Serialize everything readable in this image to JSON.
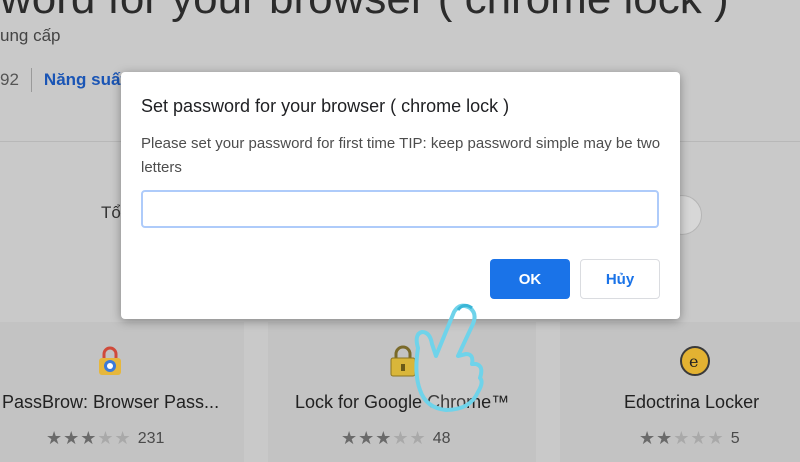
{
  "background": {
    "page_title": "word for your browser ( chrome lock )",
    "publisher": "ung cấp",
    "user_count": "92",
    "category": "Năng suất",
    "section_label": "Tổ",
    "cards": [
      {
        "title": "PassBrow: Browser Pass...",
        "rating": 3.5,
        "review_count": "231",
        "icon": "passbrow-lock-icon"
      },
      {
        "title": "Lock for Google Chrome™",
        "rating": 3,
        "review_count": "48",
        "icon": "padlock-icon"
      },
      {
        "title": "Edoctrina Locker",
        "rating": 2.5,
        "review_count": "5",
        "icon": "edoctrina-icon"
      }
    ]
  },
  "dialog": {
    "title": "Set password for your browser ( chrome lock )",
    "message": "Please set your password for first time  TIP: keep password simple may be two letters",
    "input_value": "",
    "ok_label": "OK",
    "cancel_label": "Hủy"
  },
  "colors": {
    "accent": "#1a73e8",
    "input_focus_border": "#aecbfa",
    "overlay": "#c9c9c9"
  }
}
